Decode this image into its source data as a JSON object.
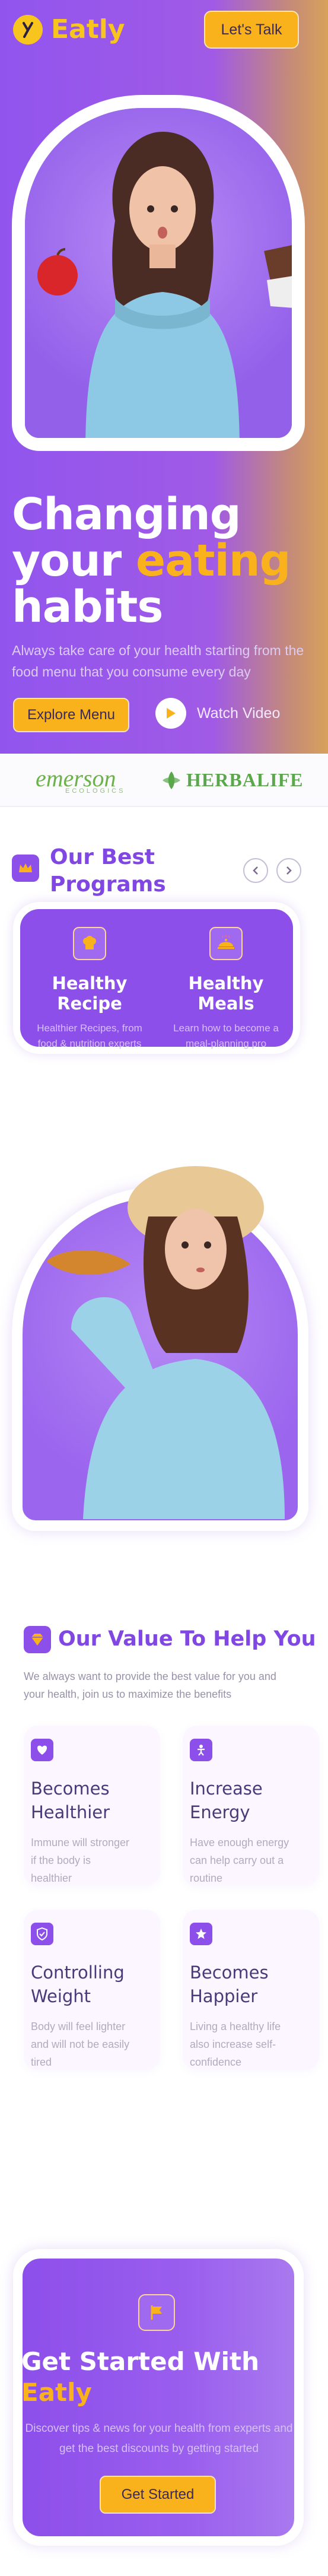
{
  "brand": {
    "name": "Eatly"
  },
  "header": {
    "cta_label": "Let's Talk"
  },
  "hero": {
    "headline_line1": "Changing",
    "headline_line2_a": "your ",
    "headline_line2_b": "eating",
    "headline_line3": "habits",
    "subtitle": "Always take care of your health starting from the food menu that you consume every day",
    "primary_button": "Explore Menu",
    "secondary_button": "Watch Video"
  },
  "partners": {
    "emerson": "emerson",
    "emerson_sub": "ECOLOGICS",
    "herbalife": "HERBALIFE"
  },
  "programs": {
    "title": "Our Best Programs",
    "items": [
      {
        "title": "Healthy Recipe",
        "desc": "Healthier Recipes, from food & nutrition experts"
      },
      {
        "title": "Healthy Meals",
        "desc": "Learn how to become a meal-planning pro"
      }
    ]
  },
  "values": {
    "title": "Our Value To Help You",
    "subtitle": "We always want to provide the best value for you and your health, join us to maximize the benefits",
    "cards": [
      {
        "title": "Becomes Healthier",
        "desc": "Immune will stronger if the body is healthier",
        "icon": "heart-icon"
      },
      {
        "title": "Increase Energy",
        "desc": "Have enough energy can help carry out a routine",
        "icon": "person-icon"
      },
      {
        "title": "Controlling Weight",
        "desc": "Body will feel lighter and will not be easily tired",
        "icon": "shield-icon"
      },
      {
        "title": "Becomes Happier",
        "desc": "Living a healthy life also increase self-confidence",
        "icon": "star-icon"
      }
    ]
  },
  "get_started": {
    "title_a": "Get Started With",
    "title_b": "Eatly",
    "desc": "Discover tips & news for your health from experts and get the best discounts by getting started",
    "button": "Get Started"
  },
  "colors": {
    "primary": "#8d4fea",
    "accent": "#f9b21c",
    "heading": "#8147e2"
  }
}
